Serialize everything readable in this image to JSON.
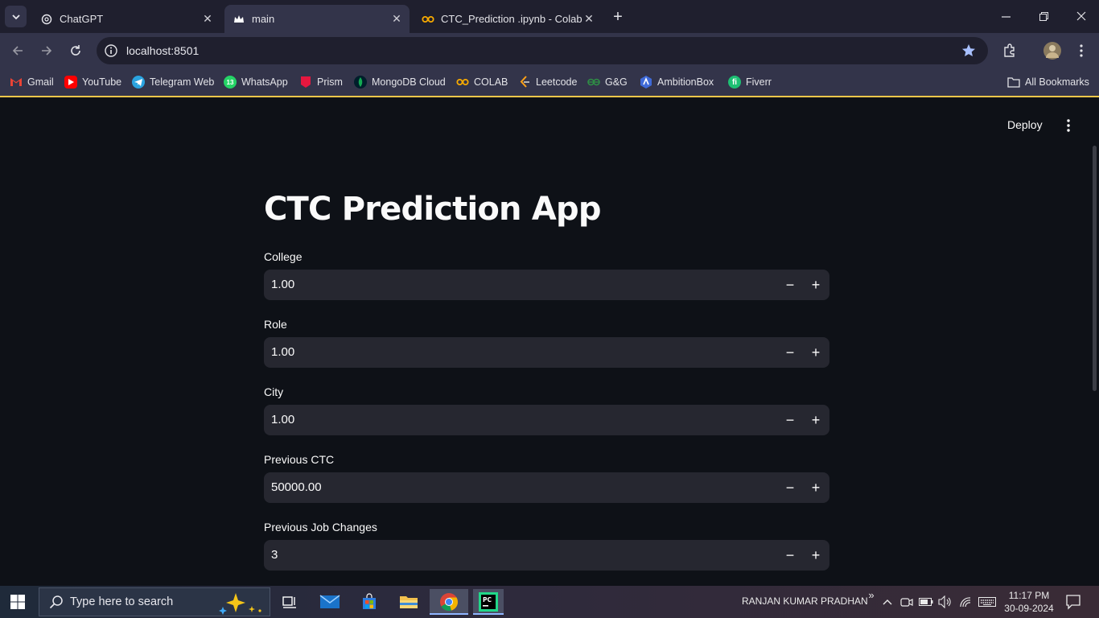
{
  "browser": {
    "tabs": [
      {
        "title": "ChatGPT",
        "active": false
      },
      {
        "title": "main",
        "active": true
      },
      {
        "title": "CTC_Prediction .ipynb - Colab",
        "active": false
      }
    ],
    "url": "localhost:8501",
    "bookmarks": [
      {
        "label": "Gmail",
        "icon": "gmail-icon",
        "color": "#ea4335"
      },
      {
        "label": "YouTube",
        "icon": "youtube-icon",
        "color": "#ff0000"
      },
      {
        "label": "Telegram Web",
        "icon": "telegram-icon",
        "color": "#2aa3e0"
      },
      {
        "label": "WhatsApp",
        "icon": "whatsapp-icon",
        "color": "#25d366"
      },
      {
        "label": "Prism",
        "icon": "prism-icon",
        "color": "#e5173f"
      },
      {
        "label": "MongoDB Cloud",
        "icon": "mongodb-icon",
        "color": "#13aa52"
      },
      {
        "label": "COLAB",
        "icon": "colab-icon",
        "color": "#f9ab00"
      },
      {
        "label": "Leetcode",
        "icon": "leetcode-icon",
        "color": "#ffa116"
      },
      {
        "label": "G&G",
        "icon": "gfg-icon",
        "color": "#2f8d46"
      },
      {
        "label": "AmbitionBox",
        "icon": "ambitionbox-icon",
        "color": "#3f6ad8"
      },
      {
        "label": "Fiverr",
        "icon": "fiverr-icon",
        "color": "#1dbf73"
      }
    ],
    "all_bookmarks": "All Bookmarks",
    "whatsapp_badge": "13"
  },
  "app": {
    "deploy_label": "Deploy",
    "title": "CTC Prediction App",
    "fields": [
      {
        "label": "College",
        "value": "1.00"
      },
      {
        "label": "Role",
        "value": "1.00"
      },
      {
        "label": "City",
        "value": "1.00"
      },
      {
        "label": "Previous CTC",
        "value": "50000.00"
      },
      {
        "label": "Previous Job Changes",
        "value": "3"
      }
    ],
    "minus_symbol": "−",
    "plus_symbol": "+"
  },
  "taskbar": {
    "search_placeholder": "Type here to search",
    "user": "RANJAN KUMAR PRADHAN",
    "overflow": "»",
    "time": "11:17 PM",
    "date": "30-09-2024"
  },
  "colors": {
    "accent_star": "#a8c0ff",
    "bookmark_border": "#f0c64a",
    "field_bg": "#262730",
    "page_bg": "#0e1117"
  }
}
